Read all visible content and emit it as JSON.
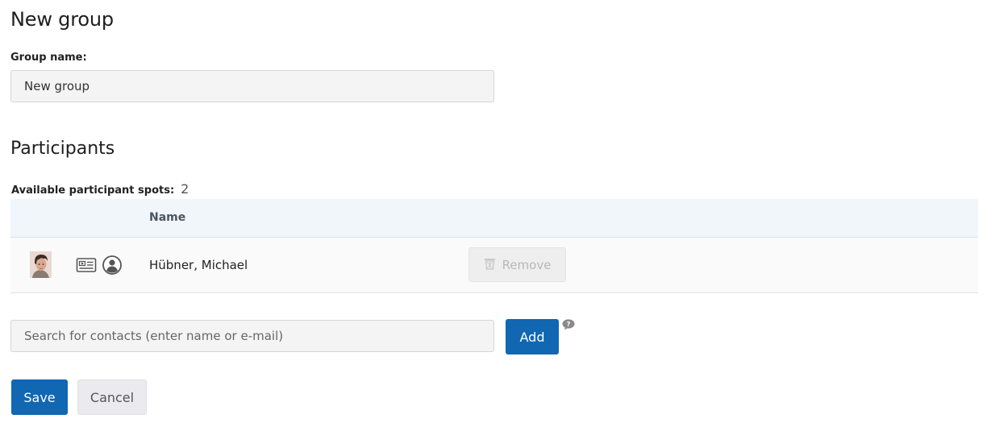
{
  "page": {
    "title": "New group"
  },
  "group_name": {
    "label": "Group name:",
    "value": "New group"
  },
  "participants": {
    "title": "Participants",
    "spots_label": "Available participant spots:",
    "spots_value": "2",
    "columns": [
      "Name"
    ],
    "rows": [
      {
        "name": "Hübner, Michael",
        "icons": [
          "avatar-photo",
          "vcard-icon",
          "person-icon"
        ],
        "remove_label": "Remove",
        "remove_icon": "trash-icon",
        "remove_disabled": true
      }
    ]
  },
  "search": {
    "placeholder": "Search for contacts (enter name or e-mail)",
    "value": "",
    "add_label": "Add",
    "help_icon": "help-bubble-icon"
  },
  "actions": {
    "save_label": "Save",
    "cancel_label": "Cancel"
  },
  "colors": {
    "primary": "#1167b1",
    "table_header_bg": "#f1f6fb",
    "input_bg": "#f4f4f4",
    "disabled_button_bg": "#eeeeee",
    "secondary_button_bg": "#ebebef"
  }
}
